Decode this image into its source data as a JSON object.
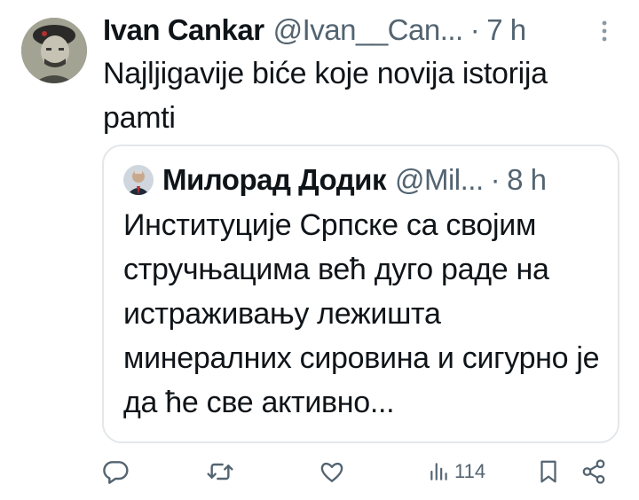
{
  "tweet": {
    "author_name": "Ivan Cankar",
    "author_handle": "@Ivan__Can...",
    "separator": "·",
    "time": "7 h",
    "text": "Najljigavije biće koje novija istorija pamti"
  },
  "quoted_tweet": {
    "author_name": "Милорад Додик",
    "author_handle": "@Mil...",
    "separator": "·",
    "time": "8 h",
    "text": "Институције Српске са својим стручњацима већ дуго раде на истраживању лежишта минералних сировина и сигурно је да ће све активно..."
  },
  "actions": {
    "views_count": "114"
  },
  "colors": {
    "text_primary": "#0f1419",
    "text_secondary": "#536471",
    "border": "#e3e7ea"
  },
  "icons": [
    "more-icon",
    "reply-icon",
    "retweet-icon",
    "like-icon",
    "views-icon",
    "bookmark-icon",
    "share-icon"
  ]
}
